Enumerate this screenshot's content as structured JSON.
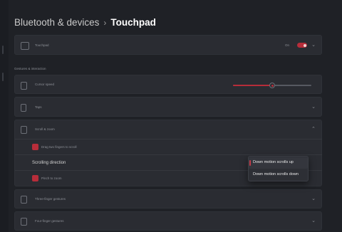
{
  "breadcrumb": {
    "parent": "Bluetooth & devices",
    "separator": "›",
    "current": "Touchpad"
  },
  "touchpad_row": {
    "label": "Touchpad",
    "toggle_text": "On",
    "toggle_on": true
  },
  "section_header": "Gestures & interaction",
  "cursor_speed": {
    "label": "Cursor speed",
    "value_fraction": 0.5
  },
  "taps": {
    "label": "Taps"
  },
  "scroll_zoom": {
    "label": "Scroll & zoom",
    "drag_scroll_label": "Drag two fingers to scroll",
    "scrolling_direction_label": "Scrolling direction",
    "pinch_zoom_label": "Pinch to zoom",
    "dropdown_options": [
      "Down motion scrolls up",
      "Down motion scrolls down"
    ],
    "selected_option": "Down motion scrolls up"
  },
  "three_finger": {
    "label": "Three-finger gestures"
  },
  "four_finger": {
    "label": "Four-finger gestures"
  },
  "colors": {
    "accent": "#b72d3a",
    "card": "#2a2c32",
    "background": "#1f2126"
  }
}
